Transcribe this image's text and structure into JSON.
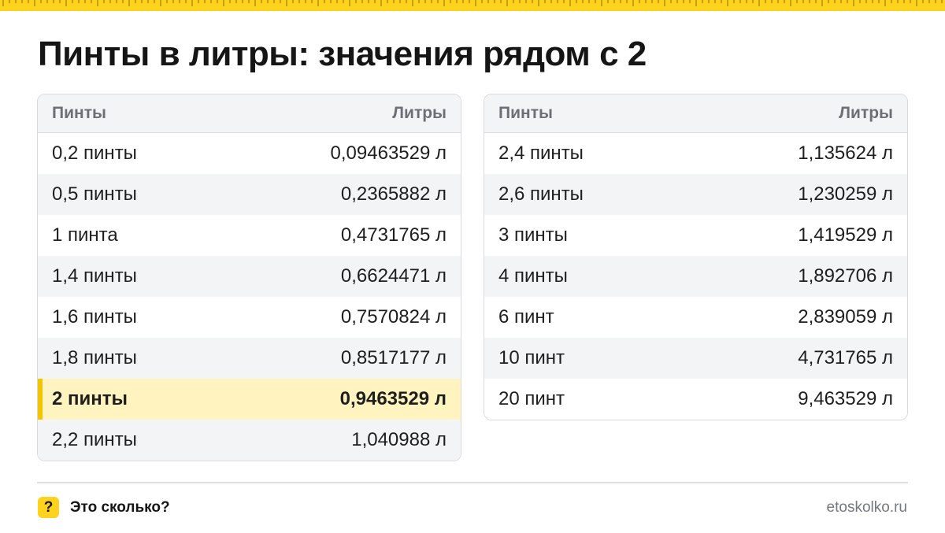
{
  "title": "Пинты в литры: значения рядом с 2",
  "tables": [
    {
      "header": {
        "left": "Пинты",
        "right": "Литры"
      },
      "rows": [
        {
          "pints": "0,2 пинты",
          "liters": "0,09463529 л"
        },
        {
          "pints": "0,5 пинты",
          "liters": "0,2365882 л"
        },
        {
          "pints": "1 пинта",
          "liters": "0,4731765 л"
        },
        {
          "pints": "1,4 пинты",
          "liters": "0,6624471 л"
        },
        {
          "pints": "1,6 пинты",
          "liters": "0,7570824 л"
        },
        {
          "pints": "1,8 пинты",
          "liters": "0,8517177 л"
        },
        {
          "pints": "2 пинты",
          "liters": "0,9463529 л",
          "highlighted": true
        },
        {
          "pints": "2,2 пинты",
          "liters": "1,040988 л"
        }
      ]
    },
    {
      "header": {
        "left": "Пинты",
        "right": "Литры"
      },
      "rows": [
        {
          "pints": "2,4 пинты",
          "liters": "1,135624 л"
        },
        {
          "pints": "2,6 пинты",
          "liters": "1,230259 л"
        },
        {
          "pints": "3 пинты",
          "liters": "1,419529 л"
        },
        {
          "pints": "4 пинты",
          "liters": "1,892706 л"
        },
        {
          "pints": "6 пинт",
          "liters": "2,839059 л"
        },
        {
          "pints": "10 пинт",
          "liters": "4,731765 л"
        },
        {
          "pints": "20 пинт",
          "liters": "9,463529 л"
        }
      ]
    }
  ],
  "footer": {
    "badge_icon": "question-mark-icon",
    "badge_text": "?",
    "brand": "Это сколько?",
    "site": "etoskolko.ru"
  },
  "colors": {
    "accent_yellow": "#ffd21e",
    "highlight_bg": "#fff3c0",
    "highlight_bar": "#f5c400",
    "stripe_bg": "#f3f4f6"
  }
}
